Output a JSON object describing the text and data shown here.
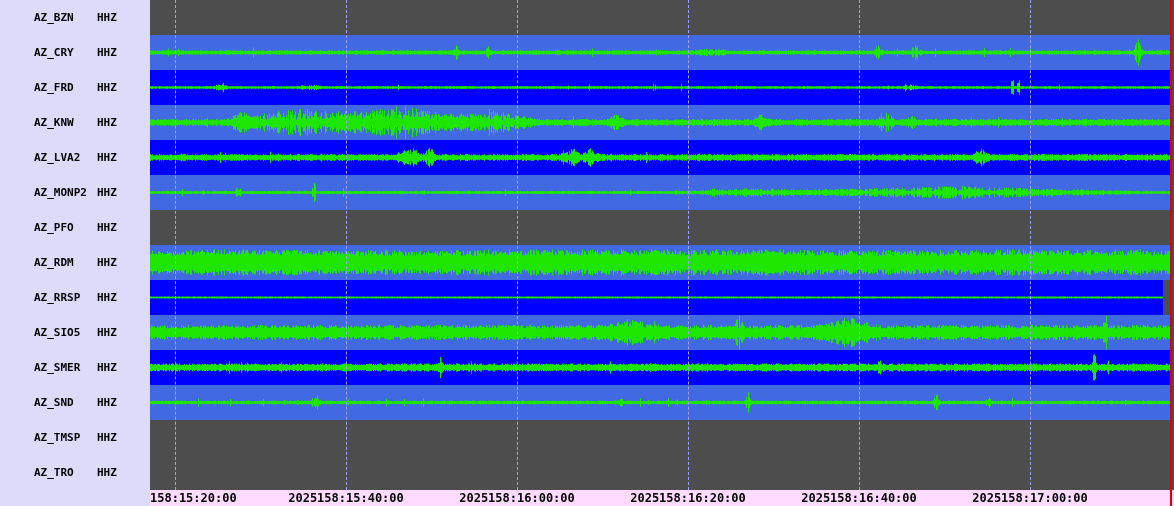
{
  "channels": [
    {
      "station": "AZ_BZN",
      "channel": "HHZ",
      "kind": "empty"
    },
    {
      "station": "AZ_CRY",
      "channel": "HHZ",
      "kind": "trace",
      "color": "#4169e1"
    },
    {
      "station": "AZ_FRD",
      "channel": "HHZ",
      "kind": "trace",
      "color": "#0000ff"
    },
    {
      "station": "AZ_KNW",
      "channel": "HHZ",
      "kind": "trace",
      "color": "#4169e1"
    },
    {
      "station": "AZ_LVA2",
      "channel": "HHZ",
      "kind": "trace",
      "color": "#0000ff"
    },
    {
      "station": "AZ_MONP2",
      "channel": "HHZ",
      "kind": "trace",
      "color": "#4169e1"
    },
    {
      "station": "AZ_PFO",
      "channel": "HHZ",
      "kind": "empty"
    },
    {
      "station": "AZ_RDM",
      "channel": "HHZ",
      "kind": "trace",
      "color": "#4169e1"
    },
    {
      "station": "AZ_RRSP",
      "channel": "HHZ",
      "kind": "trace",
      "color": "#0000ff"
    },
    {
      "station": "AZ_SIO5",
      "channel": "HHZ",
      "kind": "trace",
      "color": "#4169e1"
    },
    {
      "station": "AZ_SMER",
      "channel": "HHZ",
      "kind": "trace",
      "color": "#0000ff"
    },
    {
      "station": "AZ_SND",
      "channel": "HHZ",
      "kind": "trace",
      "color": "#4169e1"
    },
    {
      "station": "AZ_TMSP",
      "channel": "HHZ",
      "kind": "empty"
    },
    {
      "station": "AZ_TRO",
      "channel": "HHZ",
      "kind": "empty"
    }
  ],
  "time_axis": [
    "158:15:20:00",
    "2025158:15:40:00",
    "2025158:16:00:00",
    "2025158:16:20:00",
    "2025158:16:40:00",
    "2025158:17:00:00"
  ]
}
